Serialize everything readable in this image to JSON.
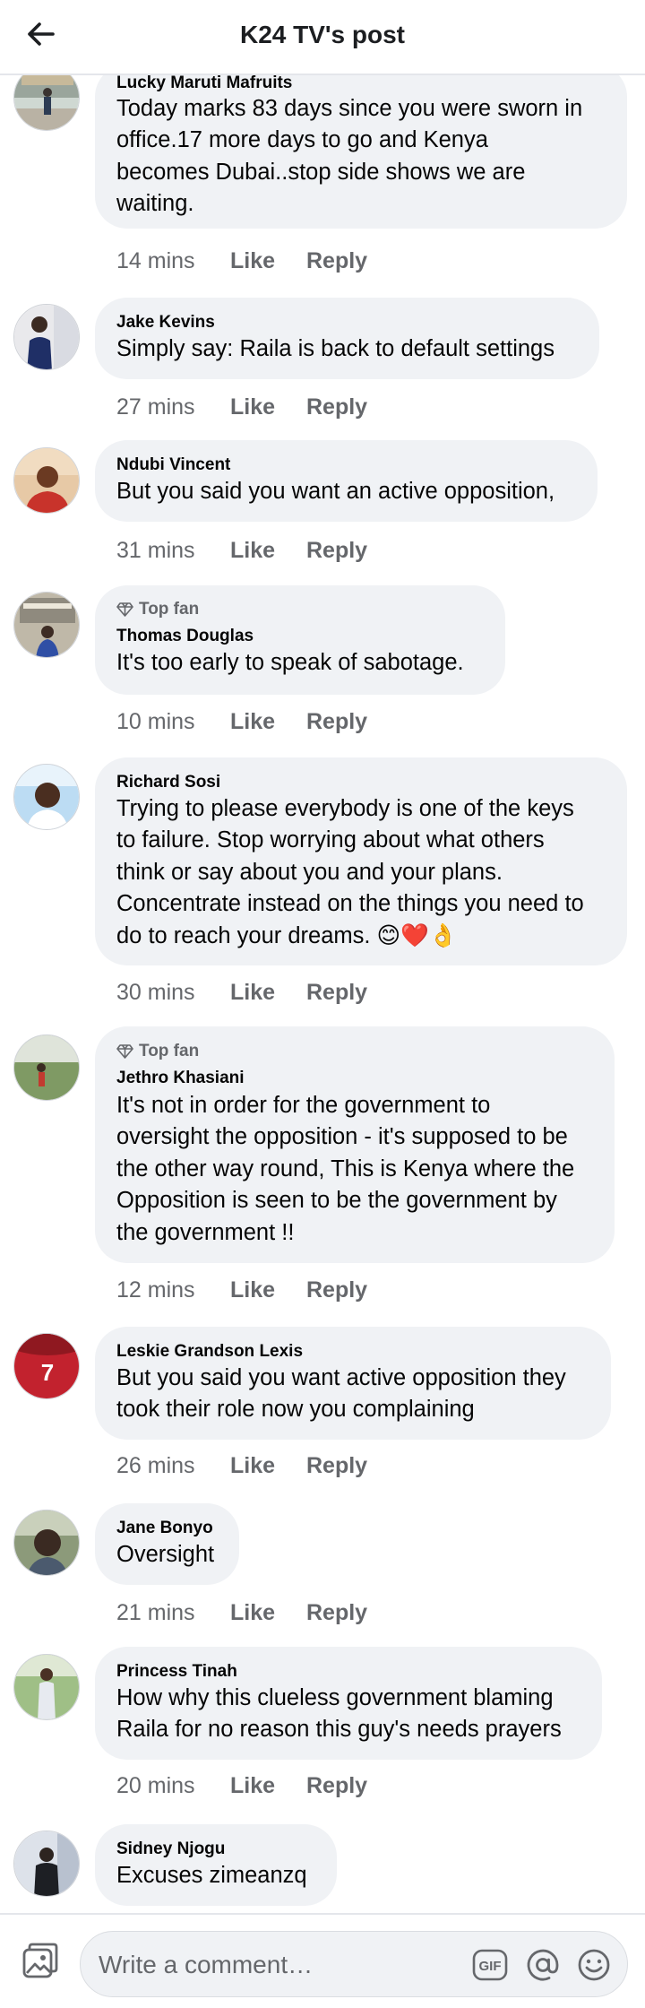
{
  "header": {
    "title": "K24 TV's post",
    "back_icon": "back-arrow-icon"
  },
  "comments": [
    {
      "author": "Lucky Maruti Mafruits",
      "lines": [
        "Today marks 83 days since you were sworn in",
        "office.17 more days to go and Kenya",
        "becomes Dubai..stop side shows we are",
        "waiting."
      ],
      "time": "14 mins",
      "like": "Like",
      "reply": "Reply"
    },
    {
      "author": "Jake Kevins",
      "lines": [
        "Simply say: Raila is back to default settings"
      ],
      "time": "27 mins",
      "like": "Like",
      "reply": "Reply"
    },
    {
      "author": "Ndubi Vincent",
      "lines": [
        "But you said you want an active opposition,"
      ],
      "time": "31 mins",
      "like": "Like",
      "reply": "Reply"
    },
    {
      "badge": "Top fan",
      "author": "Thomas Douglas",
      "lines": [
        "It's too early to speak of sabotage."
      ],
      "time": "10 mins",
      "like": "Like",
      "reply": "Reply"
    },
    {
      "author": "Richard Sosi",
      "lines": [
        "Trying to please everybody is one of the keys",
        "to failure. Stop worrying about what others",
        "think or say about you and your plans.",
        "Concentrate instead on the things you need to",
        "do to reach your dreams. 😊❤️👌"
      ],
      "time": "30 mins",
      "like": "Like",
      "reply": "Reply"
    },
    {
      "badge": "Top fan",
      "author": "Jethro Khasiani",
      "lines": [
        "It's not in order for the government to",
        "oversight the opposition - it's supposed to be",
        "the other way round, This is Kenya where the",
        "Opposition is seen to be the government by",
        "the government !!"
      ],
      "time": "12 mins",
      "like": "Like",
      "reply": "Reply"
    },
    {
      "author": "Leskie Grandson Lexis",
      "lines": [
        "But you said you want active opposition they",
        "took their role now you complaining"
      ],
      "time": "26 mins",
      "like": "Like",
      "reply": "Reply"
    },
    {
      "author": "Jane Bonyo",
      "lines": [
        "Oversight"
      ],
      "time": "21 mins",
      "like": "Like",
      "reply": "Reply"
    },
    {
      "author": "Princess Tinah",
      "lines": [
        "How why this clueless government blaming",
        "Raila for no reason this guy's needs prayers"
      ],
      "time": "20 mins",
      "like": "Like",
      "reply": "Reply"
    },
    {
      "author": "Sidney Njogu",
      "lines": [
        "Excuses zimeanzq"
      ]
    }
  ],
  "composer": {
    "placeholder": "Write a comment…",
    "gif_label": "GIF",
    "icons": [
      "photo-icon",
      "gif-icon",
      "at-mention-icon",
      "emoji-icon"
    ]
  },
  "colors": {
    "bubble": "#f0f2f5",
    "secondary_text": "#65676b",
    "primary_text": "#050505",
    "divider": "#e4e6eb",
    "top_fan_badge": "#65676b"
  }
}
